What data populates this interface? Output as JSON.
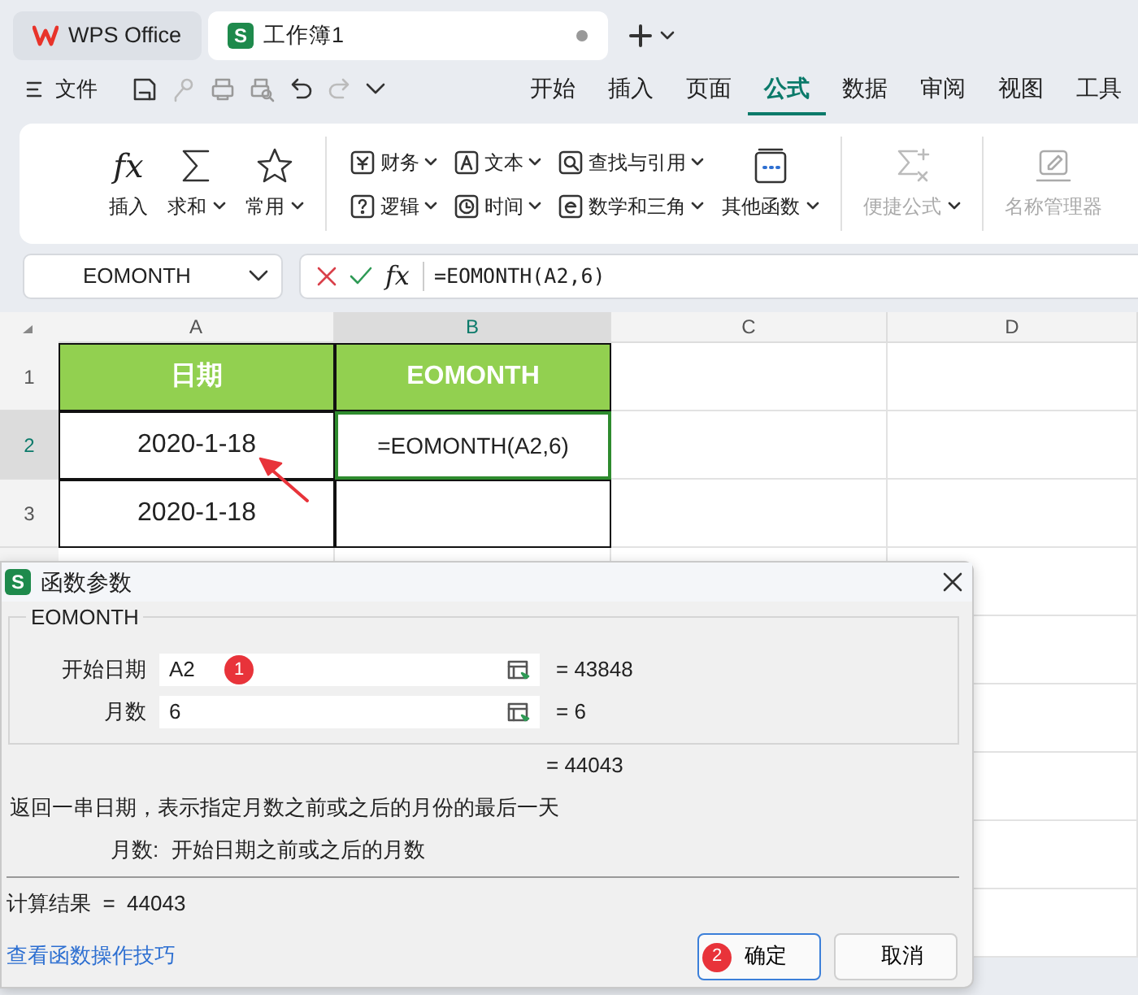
{
  "title_tabs": [
    {
      "kind": "home",
      "label": "WPS Office",
      "selected": false
    },
    {
      "kind": "doc",
      "icon_text": "S",
      "label": "工作簿1",
      "selected": true,
      "unsaved": true
    }
  ],
  "file_menu": "文件",
  "menu_tabs": [
    {
      "label": "开始",
      "selected": false
    },
    {
      "label": "插入",
      "selected": false
    },
    {
      "label": "页面",
      "selected": false
    },
    {
      "label": "公式",
      "selected": true
    },
    {
      "label": "数据",
      "selected": false
    },
    {
      "label": "审阅",
      "selected": false
    },
    {
      "label": "视图",
      "selected": false
    },
    {
      "label": "工具",
      "selected": false
    }
  ],
  "ribbon_groups": [
    {
      "kind": "large",
      "items": [
        {
          "glyph": "fx",
          "label": "插入",
          "dropdown": false,
          "disabled": false
        },
        {
          "label": "求和",
          "dropdown": true,
          "disabled": false
        },
        {
          "label": "常用",
          "dropdown": true,
          "disabled": false
        }
      ]
    },
    {
      "kind": "small",
      "items": [
        {
          "label": "财务",
          "dropdown": true,
          "disabled": false
        },
        {
          "label": "文本",
          "dropdown": true,
          "disabled": false
        },
        {
          "label": "查找与引用",
          "dropdown": true,
          "disabled": false
        },
        {
          "label": "逻辑",
          "dropdown": true,
          "disabled": false
        },
        {
          "label": "时间",
          "dropdown": true,
          "disabled": false
        },
        {
          "label": "数学和三角",
          "dropdown": true,
          "disabled": false
        }
      ]
    },
    {
      "kind": "large",
      "items": [
        {
          "label": "其他函数",
          "dropdown": true,
          "disabled": false
        }
      ]
    },
    {
      "kind": "large",
      "items": [
        {
          "label": "便捷公式",
          "dropdown": true,
          "disabled": true
        }
      ]
    },
    {
      "kind": "large",
      "items": [
        {
          "label": "名称管理器",
          "dropdown": false,
          "disabled": true
        }
      ]
    }
  ],
  "name_box": "EOMONTH",
  "formula_bar": {
    "glyph": "fx",
    "formula": "=EOMONTH(A2,6)"
  },
  "columns": [
    {
      "label": "A",
      "selected": false
    },
    {
      "label": "B",
      "selected": true
    },
    {
      "label": "C",
      "selected": false
    },
    {
      "label": "D",
      "selected": false
    }
  ],
  "rows": [
    {
      "label": "1",
      "selected": false,
      "cells": [
        {
          "text": "日期",
          "kind": "header"
        },
        {
          "text": "EOMONTH",
          "kind": "header"
        },
        {
          "text": "",
          "kind": "blank"
        },
        {
          "text": "",
          "kind": "blank"
        }
      ]
    },
    {
      "label": "2",
      "selected": true,
      "cells": [
        {
          "text": "2020-1-18",
          "kind": "data"
        },
        {
          "text": "=EOMONTH(A2,6)",
          "kind": "active"
        },
        {
          "text": "",
          "kind": "blank"
        },
        {
          "text": "",
          "kind": "blank"
        }
      ]
    },
    {
      "label": "3",
      "selected": false,
      "cells": [
        {
          "text": "2020-1-18",
          "kind": "data"
        },
        {
          "text": "",
          "kind": "data"
        },
        {
          "text": "",
          "kind": "blank"
        },
        {
          "text": "",
          "kind": "blank"
        }
      ]
    }
  ],
  "dialog": {
    "icon_text": "S",
    "title": "函数参数",
    "function_name": "EOMONTH",
    "arguments": [
      {
        "label": "开始日期",
        "value": "A2",
        "result": "=  43848",
        "badge": "1"
      },
      {
        "label": "月数",
        "value": "6",
        "result": "=  6"
      }
    ],
    "formula_result": "=  44043",
    "description": "返回一串日期，表示指定月数之前或之后的月份的最后一天",
    "help_label": "月数:",
    "help_text": "开始日期之前或之后的月数",
    "calc_result": "计算结果  =  44043",
    "link": "查看函数操作技巧",
    "buttons": [
      {
        "label": "确定",
        "primary": true,
        "badge": "2"
      },
      {
        "label": "取消",
        "primary": false
      }
    ]
  }
}
